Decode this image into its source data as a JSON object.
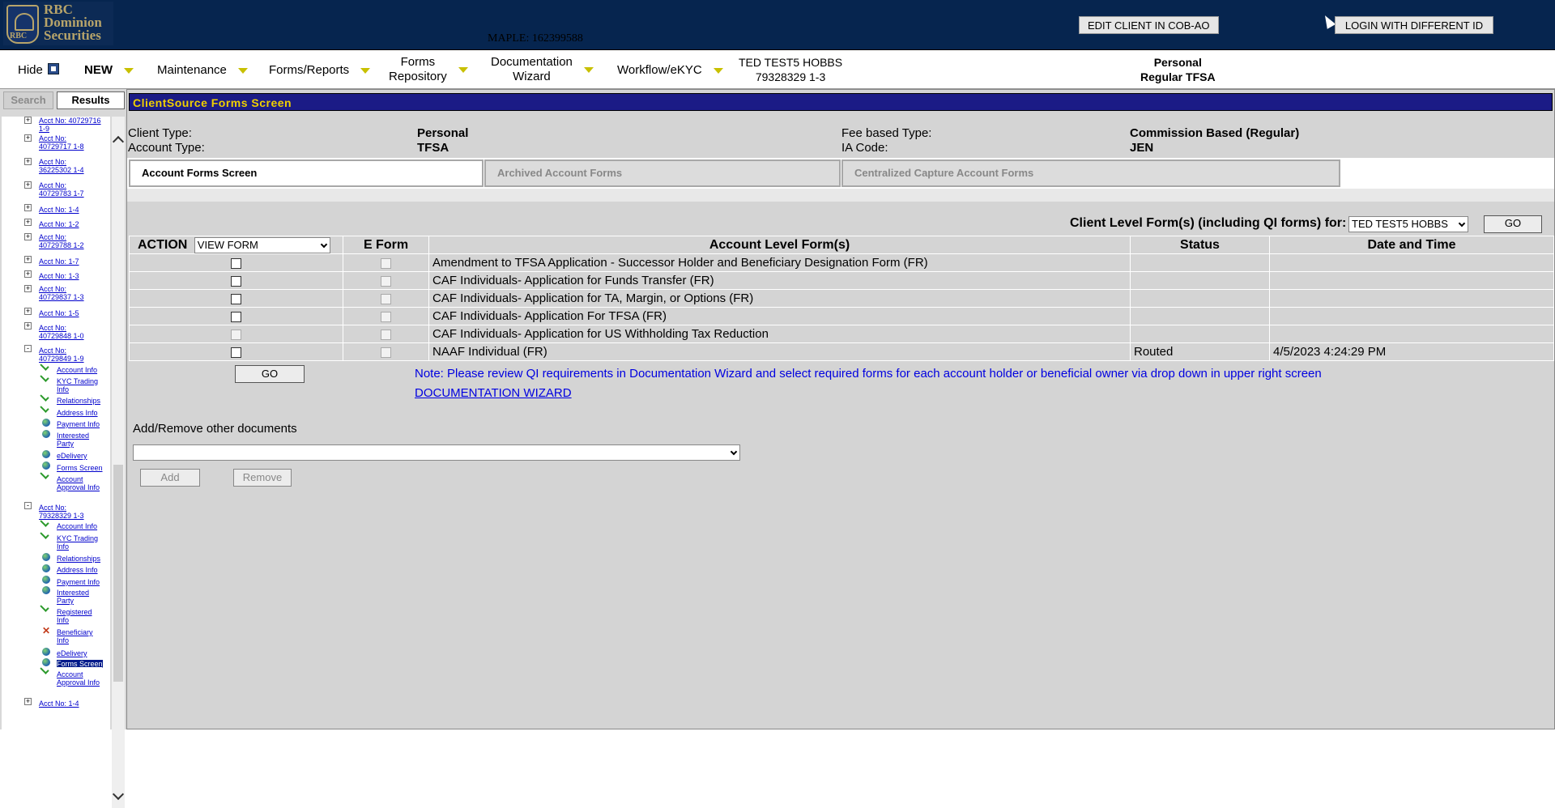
{
  "header": {
    "logo": {
      "line1": "RBC",
      "line2": "Dominion",
      "line3": "Securities",
      "mark": "RBC"
    },
    "maple_id": "MAPLE: 162399588",
    "edit_client_button": "EDIT CLIENT IN COB-AO",
    "login_button": "LOGIN WITH DIFFERENT ID",
    "bg_color": "#06254f"
  },
  "nav": {
    "hide": "Hide",
    "new": "NEW",
    "maintenance": "Maintenance",
    "forms_reports": "Forms/Reports",
    "forms_repository_1": "Forms",
    "forms_repository_2": "Repository",
    "doc_wizard_1": "Documentation",
    "doc_wizard_2": "Wizard",
    "workflow": "Workflow/eKYC",
    "client_name": "TED TEST5 HOBBS",
    "client_acct": "79328329 1-3",
    "acct_type_1": "Personal",
    "acct_type_2": "Regular TFSA"
  },
  "left_panel": {
    "search_tab": "Search",
    "results_tab": "Results",
    "tree": {
      "n1": "Acct No: 40729716 1-9",
      "n2a": "Acct No:",
      "n2b": "40729717 1-8",
      "n3a": "Acct No:",
      "n3b": "36225302 1-4",
      "n4a": "Acct No:",
      "n4b": "40729783 1-7",
      "n5": "Acct No: 1-4",
      "n6": "Acct No: 1-2",
      "n7a": "Acct No:",
      "n7b": "40729788 1-2",
      "n8": "Acct No: 1-7",
      "n9": "Acct No: 1-3",
      "n10a": "Acct No:",
      "n10b": "40729837 1-3",
      "n11": "Acct No: 1-5",
      "n12a": "Acct No:",
      "n12b": "40729848 1-0",
      "n13a": "Acct No:",
      "n13b": "40729849 1-9",
      "s1": "Account Info",
      "s2a": "KYC Trading",
      "s2b": "Info",
      "s3": "Relationships",
      "s4": "Address Info",
      "s5": "Payment Info",
      "s6a": "Interested",
      "s6b": "Party",
      "s7": "eDelivery",
      "s8": "Forms Screen",
      "s9a": "Account",
      "s9b": "Approval Info",
      "n14a": "Acct No:",
      "n14b": "79328329 1-3",
      "t1": "Account Info",
      "t2a": "KYC Trading",
      "t2b": "Info",
      "t3": "Relationships",
      "t4": "Address Info",
      "t5": "Payment Info",
      "t6a": "Interested",
      "t6b": "Party",
      "t7a": "Registered",
      "t7b": "Info",
      "t8a": "Beneficiary",
      "t8b": "Info",
      "t9": "eDelivery",
      "t10": "Forms Screen",
      "t11a": "Account",
      "t11b": "Approval Info",
      "n15": "Acct No: 1-4"
    }
  },
  "main": {
    "title": "ClientSource Forms Screen",
    "client_type_label": "Client Type:",
    "client_type_value": "Personal",
    "account_type_label": "Account Type:",
    "account_type_value": "TFSA",
    "fee_type_label": "Fee based Type:",
    "fee_type_value": "Commission Based (Regular)",
    "ia_code_label": "IA Code:",
    "ia_code_value": "JEN",
    "tabs": [
      "Account Forms Screen",
      "Archived Account Forms",
      "Centralized Capture Account Forms"
    ],
    "client_level_label": "Client Level Form(s) (including QI forms) for:",
    "client_level_select": "TED TEST5 HOBBS",
    "go_label": "GO",
    "table": {
      "headers": {
        "action": "ACTION",
        "action_select": "VIEW FORM",
        "eform": "E Form",
        "form": "Account Level Form(s)",
        "status": "Status",
        "date": "Date and Time"
      },
      "rows": [
        {
          "form": "Amendment to TFSA Application - Successor Holder and Beneficiary Designation Form (FR)",
          "status": "",
          "date": ""
        },
        {
          "form": "CAF Individuals- Application for Funds Transfer (FR)",
          "status": "",
          "date": ""
        },
        {
          "form": "CAF Individuals- Application for TA, Margin, or Options (FR)",
          "status": "",
          "date": ""
        },
        {
          "form": "CAF Individuals- Application For TFSA (FR)",
          "status": "",
          "date": ""
        },
        {
          "form": "CAF Individuals- Application for US Withholding Tax Reduction",
          "status": "",
          "date": ""
        },
        {
          "form": "NAAF Individual (FR)",
          "status": "Routed",
          "date": "4/5/2023 4:24:29 PM"
        }
      ]
    },
    "go_button": "GO",
    "note": "Note: Please review QI requirements in Documentation Wizard and select required forms for each account holder or beneficial owner via drop down in upper right screen",
    "doc_wizard_link": "DOCUMENTATION WIZARD",
    "add_remove_label": "Add/Remove other documents",
    "add_button": "Add",
    "remove_button": "Remove"
  }
}
